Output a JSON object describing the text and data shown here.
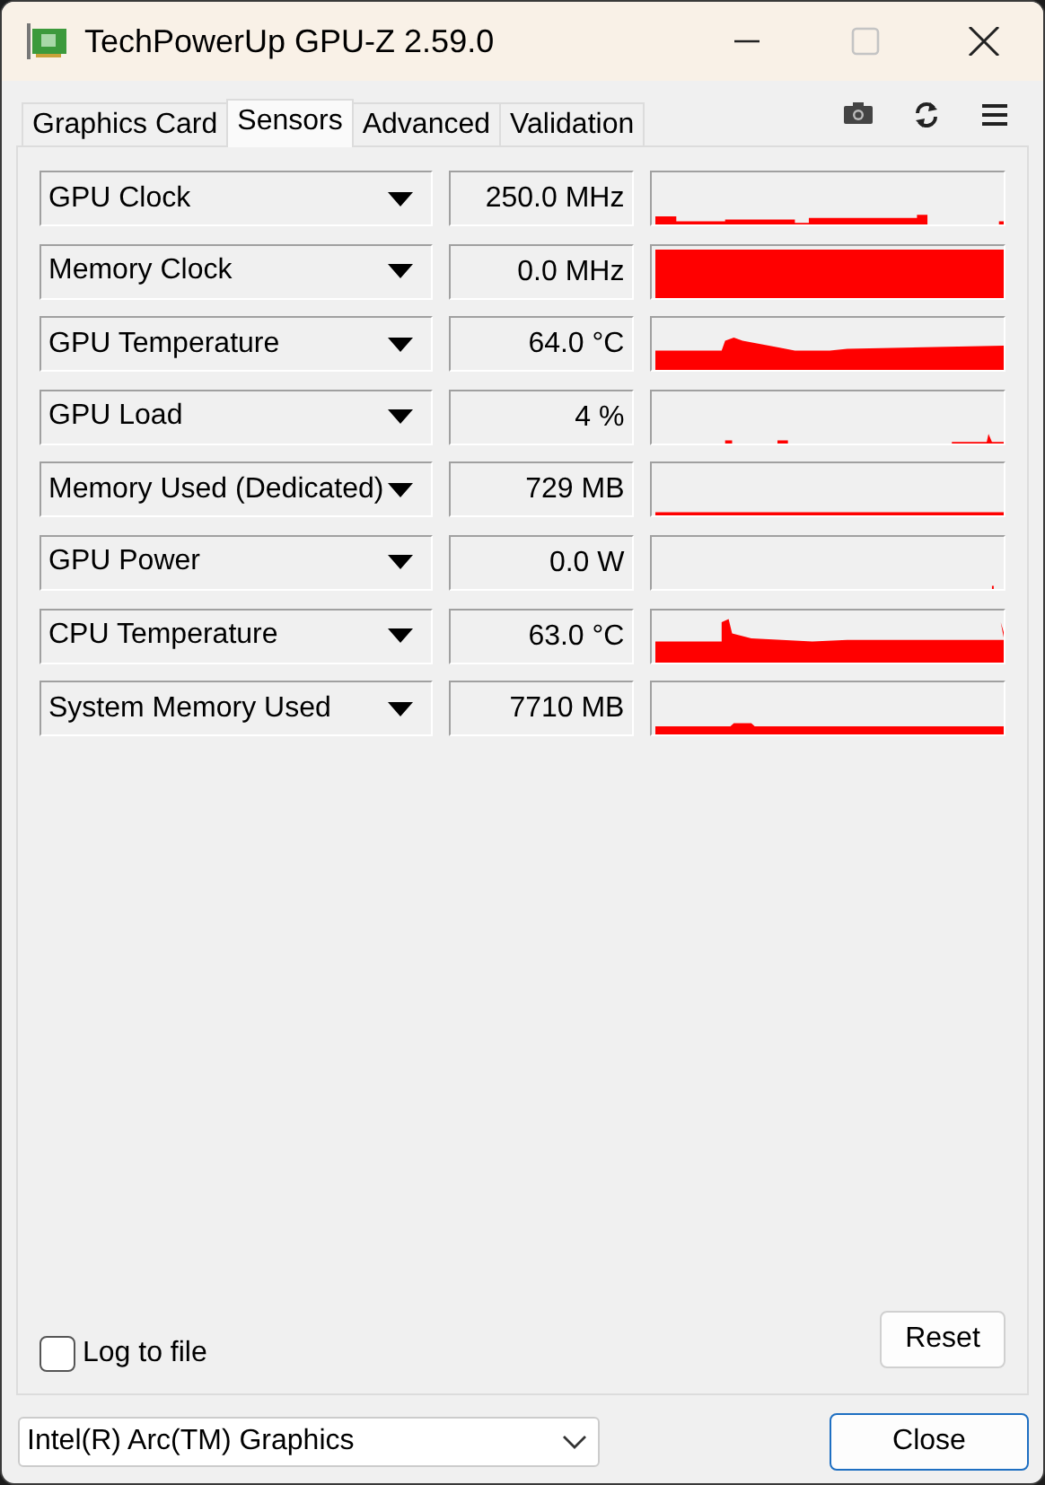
{
  "window": {
    "title": "TechPowerUp GPU-Z 2.59.0",
    "controls": [
      {
        "kind": "minimize",
        "disabled": false
      },
      {
        "kind": "maximize",
        "disabled": true
      },
      {
        "kind": "close",
        "disabled": false
      }
    ]
  },
  "tabs": [
    {
      "label": "Graphics Card",
      "selected": false
    },
    {
      "label": "Sensors",
      "selected": true
    },
    {
      "label": "Advanced",
      "selected": false
    },
    {
      "label": "Validation",
      "selected": false
    }
  ],
  "toolbar": [
    {
      "kind": "camera"
    },
    {
      "kind": "refresh"
    },
    {
      "kind": "menu"
    }
  ],
  "sensors": [
    {
      "name": "GPU Clock",
      "reading": "250.0 MHz"
    },
    {
      "name": "Memory Clock",
      "reading": "0.0 MHz"
    },
    {
      "name": "GPU Temperature",
      "reading": "64.0 °C"
    },
    {
      "name": "GPU Load",
      "reading": "4 %"
    },
    {
      "name": "Memory Used (Dedicated)",
      "reading": "729 MB"
    },
    {
      "name": "GPU Power",
      "reading": "0.0 W"
    },
    {
      "name": "CPU Temperature",
      "reading": "63.0 °C"
    },
    {
      "name": "System Memory Used",
      "reading": "7710 MB"
    }
  ],
  "log_to_file": {
    "label": "Log to file",
    "checked": false
  },
  "reset_button": "Reset",
  "gpu_select": {
    "value": "Intel(R) Arc(TM) Graphics"
  },
  "close_button": "Close"
}
